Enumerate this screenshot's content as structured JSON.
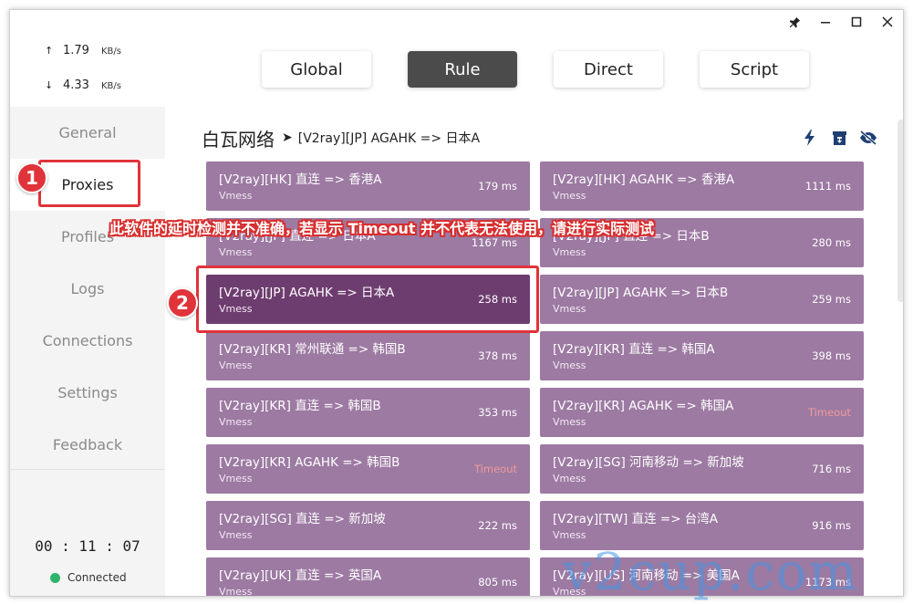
{
  "window_controls": {
    "pin": "pin-icon",
    "minimize": "—",
    "maximize": "☐",
    "close": "✕"
  },
  "traffic": {
    "up_arrow": "↑",
    "up_value": "1.79",
    "up_unit": "KB/s",
    "down_arrow": "↓",
    "down_value": "4.33",
    "down_unit": "KB/s"
  },
  "sidebar": {
    "items": [
      {
        "label": "General"
      },
      {
        "label": "Proxies"
      },
      {
        "label": "Profiles"
      },
      {
        "label": "Logs"
      },
      {
        "label": "Connections"
      },
      {
        "label": "Settings"
      },
      {
        "label": "Feedback"
      }
    ],
    "active": "Proxies",
    "uptime": "00 : 11 : 07",
    "status": "Connected",
    "status_color": "#2db36a"
  },
  "modes": {
    "global": "Global",
    "rule": "Rule",
    "direct": "Direct",
    "script": "Script",
    "active": "Rule"
  },
  "group": {
    "name": "白瓦网络",
    "arrow": "➤",
    "selected": "[V2ray][JP] AGAHK => 日本A",
    "icons": [
      "lightning-icon",
      "archive-icon",
      "eye-off-icon"
    ]
  },
  "proxies": [
    {
      "name": "[V2ray][HK] 直连 => 香港A",
      "type": "Vmess",
      "delay": "179 ms"
    },
    {
      "name": "[V2ray][HK] AGAHK => 香港A",
      "type": "Vmess",
      "delay": "1111 ms"
    },
    {
      "name": "[V2ray][JP] 直连 => 日本A",
      "type": "Vmess",
      "delay": "1167 ms"
    },
    {
      "name": "[V2ray][JP] 直连 => 日本B",
      "type": "Vmess",
      "delay": "280 ms"
    },
    {
      "name": "[V2ray][JP] AGAHK => 日本A",
      "type": "Vmess",
      "delay": "258 ms",
      "selected": true
    },
    {
      "name": "[V2ray][JP] AGAHK => 日本B",
      "type": "Vmess",
      "delay": "259 ms"
    },
    {
      "name": "[V2ray][KR] 常州联通 => 韩国B",
      "type": "Vmess",
      "delay": "378 ms"
    },
    {
      "name": "[V2ray][KR] 直连 => 韩国A",
      "type": "Vmess",
      "delay": "398 ms"
    },
    {
      "name": "[V2ray][KR] 直连 => 韩国B",
      "type": "Vmess",
      "delay": "353 ms"
    },
    {
      "name": "[V2ray][KR] AGAHK => 韩国A",
      "type": "Vmess",
      "delay": "Timeout",
      "timeout": true
    },
    {
      "name": "[V2ray][KR] AGAHK => 韩国B",
      "type": "Vmess",
      "delay": "Timeout",
      "timeout": true
    },
    {
      "name": "[V2ray][SG] 河南移动 => 新加坡",
      "type": "Vmess",
      "delay": "716 ms"
    },
    {
      "name": "[V2ray][SG] 直连 => 新加坡",
      "type": "Vmess",
      "delay": "222 ms"
    },
    {
      "name": "[V2ray][TW] 直连 => 台湾A",
      "type": "Vmess",
      "delay": "916 ms"
    },
    {
      "name": "[V2ray][UK] 直连 => 英国A",
      "type": "Vmess",
      "delay": "805 ms"
    },
    {
      "name": "[V2ray][US] 河南移动 => 美国A",
      "type": "Vmess",
      "delay": "1173 ms"
    }
  ],
  "colors": {
    "card": "#9c7aa2",
    "card_selected": "#6e3d6f",
    "timeout": "#f09a9a",
    "annotation": "#e0333a"
  },
  "annotations": {
    "badge1": "1",
    "badge2": "2",
    "note": "此软件的延时检测并不准确，若显示 Timeout 并不代表无法使用，请进行实际测试"
  },
  "watermark": "v2cup.com"
}
